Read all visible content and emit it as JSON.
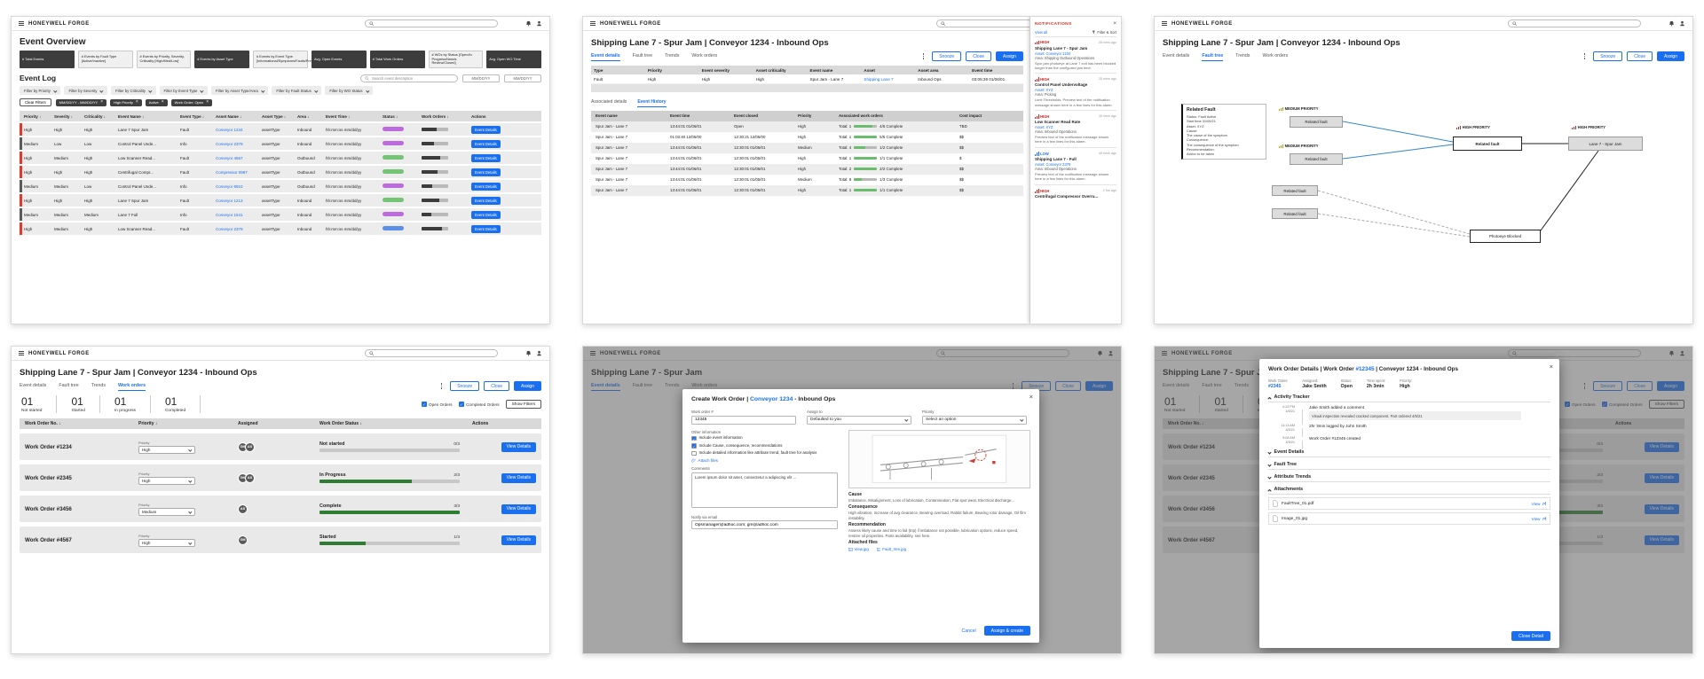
{
  "common": {
    "brand": "HONEYWELL FORGE",
    "accent": "#1a6ff0",
    "detail_title": "Shipping Lane 7 - Spur Jam | Conveyor 1234 - Inbound Ops",
    "tabs": [
      "Event details",
      "Fault tree",
      "Trends",
      "Work orders"
    ],
    "actions": {
      "snooze": "Snooze",
      "close": "Close",
      "assign": "Assign"
    }
  },
  "overview": {
    "title": "Event Overview",
    "kpis": [
      {
        "label": "# Total Events",
        "tone": "dark"
      },
      {
        "label": "# Events by Fault Type [Active/Inactive]",
        "tone": "light"
      },
      {
        "label": "# Events by Priority, Severity, Criticality [High/Med/Low]",
        "tone": "light"
      },
      {
        "label": "# Events by Asset Type",
        "tone": "dark"
      },
      {
        "label": "# Events by Event Type [Informational/Symptoms/Faults/Predictive]",
        "tone": "light"
      },
      {
        "label": "Avg. Open Events",
        "tone": "dark"
      },
      {
        "label": "# Total Work Orders",
        "tone": "dark"
      },
      {
        "label": "# WOs by Status [Open/In Progress/Needs Review/Closed]",
        "tone": "light"
      },
      {
        "label": "Avg. Open WO Time",
        "tone": "dark"
      }
    ],
    "log_title": "Event Log",
    "search_placeholder": "Search event description",
    "date_from": "MM/DD/YY",
    "date_to": "MM/DD/YY",
    "filters": [
      "Filter by Priority",
      "Filter by Severity",
      "Filter by Criticality",
      "Filter by Event Type",
      "Filter by Asset Type/Area",
      "Filter by Fault Status",
      "Filter by WO Status"
    ],
    "clear_filters": "Clear Filters",
    "active_filters": [
      "MM/DD/YY - MM/DD/YY",
      "High Priority",
      "Active",
      "Work Order: Open"
    ],
    "columns": [
      "Priority ↓",
      "Severity ↓",
      "Criticality ↓",
      "Event Name ↓",
      "Event Type ↓",
      "Asset Name ↓",
      "Asset Type ↓",
      "Area ↓",
      "Event Time ↓",
      "Status ↓",
      "Work Orders ↓",
      "Actions"
    ],
    "details_label": "Event Details",
    "rows": [
      {
        "priority": "High",
        "severity": "High",
        "criticality": "High",
        "name": "Lane 7 Spur Jam",
        "type": "Fault",
        "asset": "Conveyor 1234",
        "asset_type": "assetType",
        "area": "Inbound",
        "time": "hh:mm:ss mm/dd/yy",
        "bar": "red",
        "pill": "violet",
        "progress": 55
      },
      {
        "priority": "Medium",
        "severity": "Low",
        "criticality": "Low",
        "name": "Control Panel Unde...",
        "type": "Info",
        "asset": "Conveyor 2379",
        "asset_type": "assetType",
        "area": "Inbound",
        "time": "hh:mm:ss mm/dd/yy",
        "bar": "dark",
        "pill": "violet",
        "progress": 45
      },
      {
        "priority": "High",
        "severity": "Medium",
        "criticality": "High",
        "name": "Low Scanner Read...",
        "type": "Fault",
        "asset": "Conveyor 4567",
        "asset_type": "assetType",
        "area": "Outbound",
        "time": "hh:mm:ss mm/dd/yy",
        "bar": "red",
        "pill": "green",
        "progress": 70
      },
      {
        "priority": "High",
        "severity": "High",
        "criticality": "High",
        "name": "Centrifugal Compr...",
        "type": "Fault",
        "asset": "Compressor 0987",
        "asset_type": "assetType",
        "area": "Outbound",
        "time": "hh:mm:ss mm/dd/yy",
        "bar": "red",
        "pill": "green",
        "progress": 60
      },
      {
        "priority": "Medium",
        "severity": "Medium",
        "criticality": "Low",
        "name": "Control Panel Unde...",
        "type": "Info",
        "asset": "Conveyor 8910",
        "asset_type": "assetType",
        "area": "Outbound",
        "time": "hh:mm:ss mm/dd/yy",
        "bar": "dark",
        "pill": "violet",
        "progress": 40
      },
      {
        "priority": "High",
        "severity": "High",
        "criticality": "High",
        "name": "Lane 7 Spur Jam",
        "type": "Fault",
        "asset": "Conveyor 1213",
        "asset_type": "assetType",
        "area": "Inbound",
        "time": "hh:mm:ss mm/dd/yy",
        "bar": "red",
        "pill": "green",
        "progress": 65
      },
      {
        "priority": "Medium",
        "severity": "Medium",
        "criticality": "Medium",
        "name": "Lane 7 Full",
        "type": "Info",
        "asset": "Conveyor 1541",
        "asset_type": "assetType",
        "area": "Inbound",
        "time": "hh:mm:ss mm/dd/yy",
        "bar": "dark",
        "pill": "violet",
        "progress": 35
      },
      {
        "priority": "High",
        "severity": "Medium",
        "criticality": "High",
        "name": "Low Scanner Read...",
        "type": "Fault",
        "asset": "Conveyor 2379",
        "asset_type": "assetType",
        "area": "Inbound",
        "time": "hh:mm:ss mm/dd/yy",
        "bar": "red",
        "pill": "blue",
        "progress": 75
      }
    ]
  },
  "event_details": {
    "summary_columns": [
      "Type",
      "Priority",
      "Event severity",
      "Asset criticality",
      "Event name",
      "Asset",
      "Asset area",
      "Event time"
    ],
    "summary": {
      "type": "Fault",
      "priority": "High",
      "severity": "High",
      "criticality": "High",
      "name": "Spur Jam - Lane 7",
      "asset": "Shipping Lane 7",
      "area": "Inbound Ops",
      "time": "03:05:39 01/06/01"
    },
    "subtabs": [
      "Associated details",
      "Event History"
    ],
    "history_columns": [
      "Event name",
      "Event time",
      "Event closed",
      "Priority",
      "Associated work orders",
      "Cost impact"
    ],
    "history_rows": [
      {
        "name": "Spur Jam - Lane 7",
        "time": "13:44:01 01/06/01",
        "closed": "Open",
        "priority": "High",
        "total": "Total: 1",
        "progress": 80,
        "complete": "4/5 Complete",
        "cost": "TBD"
      },
      {
        "name": "Spur Jam - Lane 7",
        "time": "01:03:40 12/05/00",
        "closed": "12:30:21 12/05/00",
        "priority": "High",
        "total": "Total: 1",
        "progress": 100,
        "complete": "5/5 Complete",
        "cost": "$$"
      },
      {
        "name": "Spur Jam - Lane 7",
        "time": "13:44:01 01/06/01",
        "closed": "12:30:01 01/05/01",
        "priority": "Medium",
        "total": "Total: 4",
        "progress": 50,
        "complete": "1/2 Complete",
        "cost": "$$"
      },
      {
        "name": "Spur Jam - Lane 7",
        "time": "13:44:01 01/06/01",
        "closed": "12:30:01 01/05/01",
        "priority": "High",
        "total": "Total: 1",
        "progress": 100,
        "complete": "1/1 Complete",
        "cost": "$"
      },
      {
        "name": "Spur Jam - Lane 7",
        "time": "13:44:01 01/06/01",
        "closed": "12:30:01 01/05/01",
        "priority": "High",
        "total": "Total: 2",
        "progress": 100,
        "complete": "2/2 Complete",
        "cost": "$$"
      },
      {
        "name": "Spur Jam - Lane 7",
        "time": "13:44:01 01/06/01",
        "closed": "12:30:01 01/05/01",
        "priority": "Medium",
        "total": "Total: 8",
        "progress": 33,
        "complete": "1/3 Complete",
        "cost": "$$"
      },
      {
        "name": "Spur Jam - Lane 7",
        "time": "13:44:01 01/06/01",
        "closed": "12:30:01 01/05/01",
        "priority": "High",
        "total": "Total: 1",
        "progress": 100,
        "complete": "1/1 Complete",
        "cost": "$$"
      }
    ]
  },
  "notifications": {
    "title": "NOTIFICATIONS",
    "view_all": "View all",
    "filter_sort": "Filter & Sort",
    "items": [
      {
        "tag": "HIGH",
        "level": "high",
        "time": "25 mins ago",
        "title": "Shipping Lane 7 - Spur Jam",
        "asset": "Asset: Conveyor 1234",
        "area": "Area: Shipping Outbound Operations",
        "body": "Spur jam photoeye at Lane 7 exit has been blocked longer than the configured jam time."
      },
      {
        "tag": "HIGH",
        "level": "high",
        "time": "25 mins ago",
        "title": "Control Panel Undervoltage",
        "asset": "Asset: XYZ",
        "area": "Area: Picking",
        "body": "Limit Thresholds: Preview text of the notification message shown here in a few lines for this alarm."
      },
      {
        "tag": "HIGH",
        "level": "high",
        "time": "35 mins ago",
        "title": "Low Scanner Read Rate",
        "asset": "Asset: XYZ",
        "area": "Area: Inbound Operations",
        "body": "Preview text of the notification message shown here in a few lines for this alarm."
      },
      {
        "tag": "LOW",
        "level": "low",
        "time": "45 mins ago",
        "title": "Shipping Lane 7 - Full",
        "asset": "Asset: Conveyor 2379",
        "area": "Area: Inbound Operations",
        "body": "Preview text of the notification message shown here in a few lines for this alarm."
      },
      {
        "tag": "HIGH",
        "level": "high",
        "time": "2 hrs ago",
        "title": "Centrifugal Compressor Overru...",
        "asset": "",
        "area": "",
        "body": ""
      }
    ]
  },
  "fault_tree": {
    "card_title": "Related Fault",
    "card_lines": [
      "Status: Fault Active",
      "Start time 01/05/21",
      "Asset: XYZ",
      "Cause:",
      "The cause of the symptom",
      "Consequence:",
      "The consequence of the symptom",
      "Recommendation:",
      "Action to be taken"
    ],
    "medium_label": "MEDIUM PRIORITY",
    "high_label": "HIGH PRIORITY",
    "related_fault": "Related fault",
    "lane_node": "Lane 7 - Spur Jam",
    "photoeye_node": "Photoeye Blocked"
  },
  "work_orders": {
    "stats": [
      {
        "value": "01",
        "label": "Not started"
      },
      {
        "value": "01",
        "label": "Started"
      },
      {
        "value": "01",
        "label": "In progress"
      },
      {
        "value": "01",
        "label": "Completed"
      }
    ],
    "open_orders": "Open Orders",
    "completed_orders": "Completed Orders",
    "show_filters": "Show Filters",
    "columns": [
      "Work Order No. ↓",
      "Priority ↓",
      "Assigned",
      "Work Order Status ↓",
      "Actions"
    ],
    "priority_label": "Priority",
    "view_details": "View Details",
    "rows": [
      {
        "number": "Work Order #1234",
        "priority": "High",
        "a1": "GM",
        "a2": "AS",
        "status": "Not started",
        "ratio": "0/3",
        "progress": 0
      },
      {
        "number": "Work Order #2345",
        "priority": "High",
        "a1": "GM",
        "a2": "AS",
        "status": "In Progress",
        "ratio": "2/3",
        "progress": 66
      },
      {
        "number": "Work Order #3456",
        "priority": "Medium",
        "a1": "AS",
        "a2": "",
        "status": "Complete",
        "ratio": "3/3",
        "progress": 100
      },
      {
        "number": "Work Order #4567",
        "priority": "High",
        "a1": "GM",
        "a2": "",
        "status": "Started",
        "ratio": "1/3",
        "progress": 33
      }
    ]
  },
  "create_wo": {
    "bg_title": "Shipping Lane 7 - Spur Jam",
    "title_prefix": "Create Work Order | ",
    "title_asset": "Conveyor 1234",
    "title_suffix": " - Inbound Ops",
    "wo_label": "Work order #",
    "wo_value": "12345",
    "assign_label": "Assign to",
    "assign_value": "Defaulted to you",
    "priority_label": "Priority",
    "priority_value": "Select an option",
    "other_info": "Other information",
    "checks": [
      {
        "label": "Include event information",
        "on": 1
      },
      {
        "label": "Include Cause, consequence, recommendations",
        "on": 1
      },
      {
        "label": "Include detailed information like attribute trend, fault tree for analysis",
        "on": 0
      }
    ],
    "attach": "Attach files",
    "comments_label": "Comments",
    "comments_value": "Lorem ipsum dolor sit amet, consectetur a adipiscing elit ...",
    "email_label": "Notify via email",
    "email_value": "Opsmanager@adhoc.com; gm@adhoc.com",
    "cause_title": "Cause",
    "cause_body": "Imbalance, Misalignment, Loss of lubrication, Contamination, Flat spot wear, Electrical discharge...",
    "consequence_title": "Consequence",
    "consequence_body": "High vibration, Increase of avg clearance, Bearing overload, Rabbit failure, Bearing rotor damage, Oil film instability.",
    "recommendation_title": "Recommendation",
    "recommendation_body": "Assess likely cause and time to fail (trip) if imbalance not possible, lubrication options, reduce speed, restore oil properties. Parts availability, see here.",
    "attached_label": "Attached files",
    "attached_links": [
      "View.jpg",
      "Fault_tree.jpg"
    ],
    "cancel": "Cancel",
    "submit": "Assign & create"
  },
  "wo_details": {
    "title_prefix": "Work Order Details | Work Order ",
    "title_num": "#12345",
    "title_suffix": " | Conveyor 1234 - Inbound Ops",
    "info": [
      {
        "label": "Work Order:",
        "value": "#2345",
        "tone": "blue"
      },
      {
        "label": "Assigned:",
        "value": "Jake Smith",
        "tone": "plain"
      },
      {
        "label": "Status:",
        "value": "Open",
        "tone": "plain"
      },
      {
        "label": "Time spent:",
        "value": "2h 3min",
        "tone": "plain"
      },
      {
        "label": "Priority:",
        "value": "High",
        "tone": "plain"
      }
    ],
    "activity_title": "Activity Tracker",
    "timeline": [
      {
        "t1": "4:13 PM",
        "t2": "4/5/21",
        "text": "Jake Smith added a comment",
        "note": "Visual inspection revealed cracked component. Part ordered 4/5/21"
      },
      {
        "t1": "11:13 AM",
        "t2": "4/5/21",
        "text": "2hr 3min logged by John Smith",
        "note": ""
      },
      {
        "t1": "9:08 AM",
        "t2": "4/5/21",
        "text": "Work Order #12345 created",
        "note": ""
      }
    ],
    "collapsed": [
      "Event Details",
      "Fault Tree",
      "Attribute Trends"
    ],
    "attachments_title": "Attachments",
    "files": [
      {
        "name": "FaultTree_01.pdf",
        "action": "View"
      },
      {
        "name": "Image_01.jpg",
        "action": "View"
      }
    ],
    "close_detail": "Close Detail"
  }
}
